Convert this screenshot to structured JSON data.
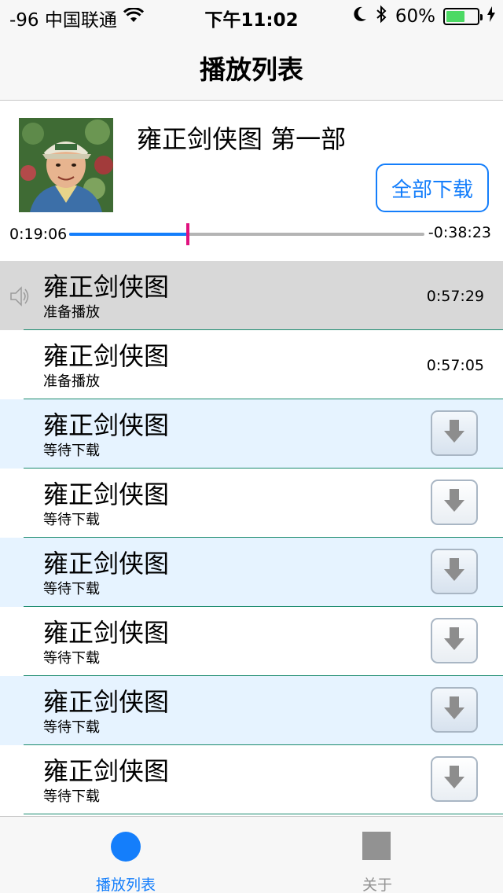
{
  "status_bar": {
    "carrier": "-96 中国联通",
    "time": "下午11:02",
    "battery": "60%",
    "battery_level": 0.6
  },
  "nav": {
    "title": "播放列表"
  },
  "header": {
    "album_title": "雍正剑侠图 第一部",
    "download_all_label": "全部下载",
    "elapsed": "0:19:06",
    "remaining": "-0:38:23",
    "progress_fraction": 0.333
  },
  "rows": [
    {
      "title": "雍正剑侠图",
      "subtitle": "准备播放",
      "duration": "0:57:29",
      "state": "playing"
    },
    {
      "title": "雍正剑侠图",
      "subtitle": "准备播放",
      "duration": "0:57:05",
      "state": "ready"
    },
    {
      "title": "雍正剑侠图",
      "subtitle": "等待下载",
      "state": "pending"
    },
    {
      "title": "雍正剑侠图",
      "subtitle": "等待下载",
      "state": "pending"
    },
    {
      "title": "雍正剑侠图",
      "subtitle": "等待下载",
      "state": "pending"
    },
    {
      "title": "雍正剑侠图",
      "subtitle": "等待下载",
      "state": "pending"
    },
    {
      "title": "雍正剑侠图",
      "subtitle": "等待下载",
      "state": "pending"
    },
    {
      "title": "雍正剑侠图",
      "subtitle": "等待下载",
      "state": "pending"
    }
  ],
  "tabs": [
    {
      "label": "播放列表",
      "icon": "circle-icon",
      "active": true
    },
    {
      "label": "关于",
      "icon": "square-icon",
      "active": false
    }
  ],
  "colors": {
    "accent": "#147efb",
    "thumb": "#e0117f",
    "battery": "#4cd964"
  }
}
